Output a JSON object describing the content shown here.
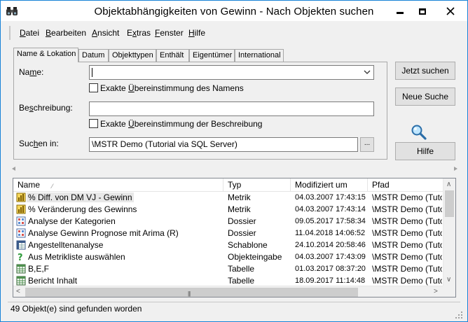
{
  "window": {
    "title": "Objektabhängigkeiten von Gewinn - Nach Objekten suchen"
  },
  "menu": {
    "items": [
      {
        "pre": "",
        "u": "D",
        "post": "atei"
      },
      {
        "pre": "",
        "u": "B",
        "post": "earbeiten"
      },
      {
        "pre": "",
        "u": "A",
        "post": "nsicht"
      },
      {
        "pre": "E",
        "u": "x",
        "post": "tras"
      },
      {
        "pre": "",
        "u": "F",
        "post": "enster"
      },
      {
        "pre": "",
        "u": "H",
        "post": "ilfe"
      }
    ]
  },
  "tabs": [
    "Name & Lokation",
    "Datum",
    "Objekttypen",
    "Enthält",
    "Eigentümer",
    "International"
  ],
  "form": {
    "name_label_pre": "Na",
    "name_label_u": "m",
    "name_label_post": "e:",
    "name_value": "",
    "exact_name_pre": "Exakte ",
    "exact_name_u": "Ü",
    "exact_name_post": "bereinstimmung des Namens",
    "desc_label_pre": "Be",
    "desc_label_u": "s",
    "desc_label_post": "chreibung:",
    "desc_value": "",
    "exact_desc_pre": "Exakte ",
    "exact_desc_u": "Ü",
    "exact_desc_post": "bereinstimmung der Beschreibung",
    "search_in_pre": "Suc",
    "search_in_u": "h",
    "search_in_post": "en in:",
    "search_in_value": "\\MSTR Demo (Tutorial via SQL Server)",
    "browse_label": "..."
  },
  "buttons": {
    "search_now": "Jetzt suchen",
    "new_search": "Neue Suche",
    "help": "Hilfe"
  },
  "results": {
    "columns": [
      "Name",
      "Typ",
      "Modifiziert um",
      "Pfad"
    ],
    "sort_indicator": "⁄",
    "rows": [
      {
        "icon": "metric-icon",
        "name": "% Diff. von DM VJ - Gewinn",
        "type": "Metrik",
        "modified": "04.03.2007 17:43:15",
        "path": "\\MSTR Demo (Tuto"
      },
      {
        "icon": "metric-icon",
        "name": "% Veränderung des Gewinns",
        "type": "Metrik",
        "modified": "04.03.2007 17:43:14",
        "path": "\\MSTR Demo (Tuto"
      },
      {
        "icon": "dossier-icon",
        "name": "Analyse der Kategorien",
        "type": "Dossier",
        "modified": "09.05.2017 17:58:34",
        "path": "\\MSTR Demo (Tuto"
      },
      {
        "icon": "dossier-icon",
        "name": "Analyse Gewinn Prognose mit Arima (R)",
        "type": "Dossier",
        "modified": "11.04.2018 14:06:52",
        "path": "\\MSTR Demo (Tuto"
      },
      {
        "icon": "template-icon",
        "name": "Angestelltenanalyse",
        "type": "Schablone",
        "modified": "24.10.2014 20:58:46",
        "path": "\\MSTR Demo (Tuto"
      },
      {
        "icon": "prompt-icon",
        "name": "Aus Metrikliste auswählen",
        "type": "Objekteingabe",
        "modified": "04.03.2007 17:43:09",
        "path": "\\MSTR Demo (Tuto"
      },
      {
        "icon": "table-icon",
        "name": "B,E,F",
        "type": "Tabelle",
        "modified": "01.03.2017 08:37:20",
        "path": "\\MSTR Demo (Tuto"
      },
      {
        "icon": "table-icon",
        "name": "Bericht Inhalt",
        "type": "Tabelle",
        "modified": "18.09.2017 11:14:48",
        "path": "\\MSTR Demo (Tuto"
      }
    ]
  },
  "status": {
    "text": "49 Objekt(e) sind gefunden worden"
  }
}
